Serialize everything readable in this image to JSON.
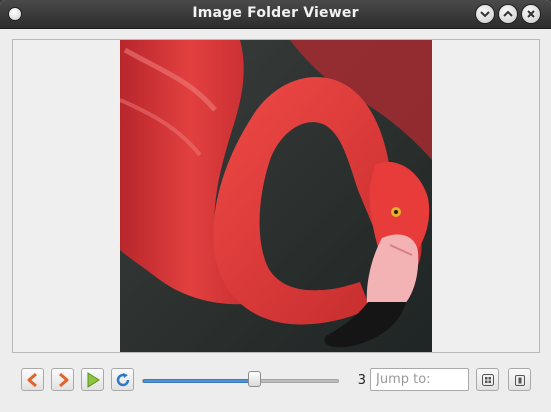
{
  "window": {
    "title": "Image Folder Viewer",
    "controls": [
      "minimize-icon",
      "maximize-icon",
      "close-icon"
    ]
  },
  "viewer": {
    "image_subject": "flamingo head and neck photo"
  },
  "toolbar": {
    "buttons": [
      "previous-arrow-icon",
      "next-arrow-icon",
      "play-icon",
      "refresh-icon",
      "fit-to-window-icon",
      "fullscreen-icon"
    ],
    "slider_position": 0.57,
    "current_index": "3",
    "jump_placeholder": "Jump to:",
    "jump_value": ""
  },
  "colors": {
    "titlebar": "#2c2c2c",
    "accent": "#4f92d6",
    "arrow": "#e0642c",
    "play": "#6fb324",
    "refresh": "#2f78c8"
  }
}
